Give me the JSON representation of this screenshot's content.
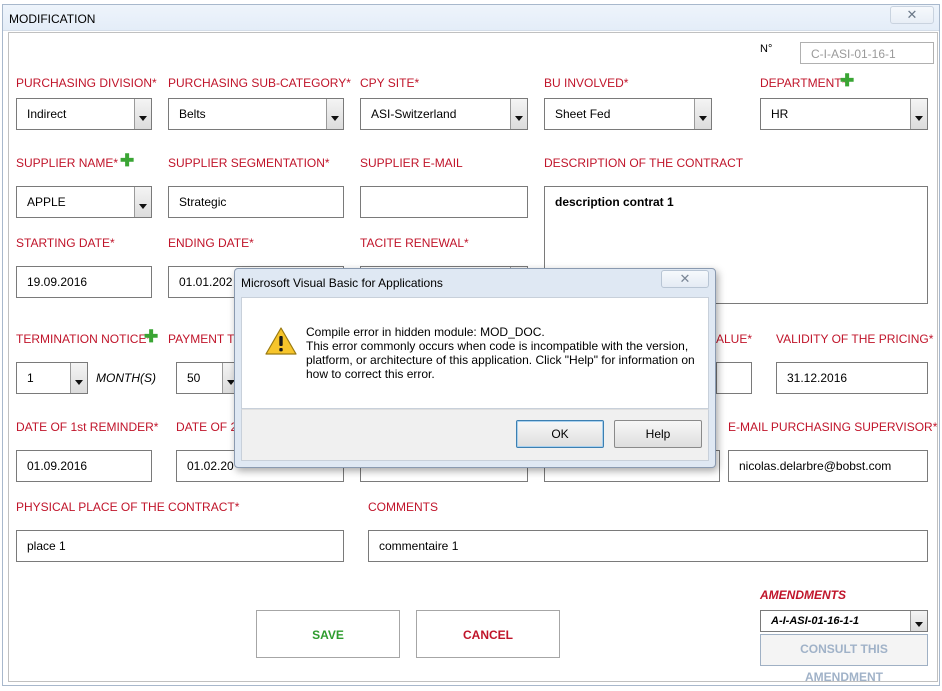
{
  "window": {
    "title": "MODIFICATION",
    "close_glyph": "✕"
  },
  "number": {
    "label": "N°",
    "value": "C-I-ASI-01-16-1"
  },
  "labels": {
    "purchasing_division": "PURCHASING DIVISION*",
    "purchasing_sub_category": "PURCHASING SUB-CATEGORY*",
    "cpy_site": "CPY SITE*",
    "bu_involved": "BU INVOLVED*",
    "department": "DEPARTMENT*",
    "supplier_name": "SUPPLIER NAME*",
    "supplier_segmentation": "SUPPLIER SEGMENTATION*",
    "supplier_email": "SUPPLIER E-MAIL",
    "description": "DESCRIPTION OF THE CONTRACT",
    "starting_date": "STARTING DATE*",
    "ending_date": "ENDING DATE*",
    "tacite_renewal": "TACITE RENEWAL*",
    "termination_notice": "TERMINATION NOTICE*",
    "payment_terms_partial": "PAYMENT TE",
    "value_partial": "ALUE*",
    "validity_pricing": "VALIDITY OF THE PRICING*",
    "date_1st_reminder": "DATE OF 1st REMINDER*",
    "date_2nd_partial": "DATE OF 2",
    "email_supervisor": "E-MAIL PURCHASING SUPERVISOR*",
    "physical_place": "PHYSICAL PLACE OF THE CONTRACT*",
    "comments": "COMMENTS",
    "amendments": "AMENDMENTS",
    "months": "MONTH(S)"
  },
  "values": {
    "purchasing_division": "Indirect",
    "purchasing_sub_category": "Belts",
    "cpy_site": "ASI-Switzerland",
    "bu_involved": "Sheet Fed",
    "department": "HR",
    "supplier_name": "APPLE",
    "supplier_segmentation": "Strategic",
    "supplier_email": "",
    "description": "description contrat 1",
    "starting_date": "19.09.2016",
    "ending_date_partial": "01.01.202",
    "termination_notice": "1",
    "payment_terms": "50",
    "validity_pricing": "31.12.2016",
    "date_1st_reminder": "01.09.2016",
    "date_2nd_partial": "01.02.20",
    "email_supervisor": "nicolas.delarbre@bobst.com",
    "physical_place": "place 1",
    "comments": "commentaire 1",
    "amendment": "A-I-ASI-01-16-1-1"
  },
  "buttons": {
    "save": "SAVE",
    "cancel": "CANCEL",
    "consult_amendment": "CONSULT THIS AMENDMENT",
    "plus_glyph": "✚"
  },
  "dialog": {
    "title": "Microsoft Visual Basic for Applications",
    "close_glyph": "✕",
    "line1": "Compile error in hidden module:  MOD_DOC.",
    "line2": "This error commonly occurs when code is incompatible with the version, platform, or architecture of this application.  Click \"Help\" for information on how to correct this error.",
    "ok": "OK",
    "help": "Help",
    "icon": "warning-icon"
  },
  "colors": {
    "label_red": "#c0142a",
    "save_green": "#2e9c2e",
    "plus_green": "#3aa534"
  }
}
